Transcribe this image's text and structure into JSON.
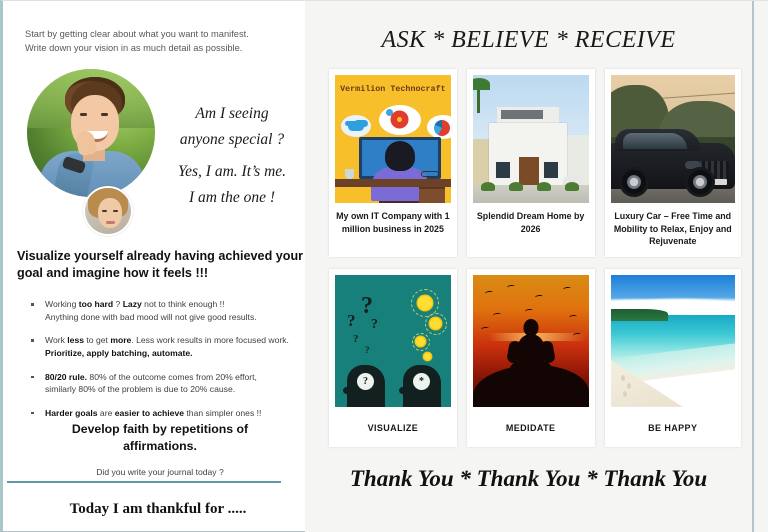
{
  "left": {
    "intro_line1": "Start by getting clear about what you want to manifest.",
    "intro_line2": "Write down your vision in as much detail as possible.",
    "quote_line1": "Am I seeing",
    "quote_line2": "anyone special ?",
    "quote_line3": "Yes, I am. It’s me.",
    "quote_line4": "I am the one !",
    "headline": "Visualize yourself already having achieved your goal and imagine how it feels !!!",
    "tips": [
      {
        "p1": "Working ",
        "b1": "too hard",
        "p2": " ? ",
        "b2": "Lazy",
        "p3": " not to think enough !!",
        "p4": "Anything done with bad mood will not give good results.",
        "b3": "",
        "p5": ""
      },
      {
        "p1": "Work ",
        "b1": "less",
        "p2": " to get ",
        "b2": "more",
        "p3": ". Less work results in more focused work. ",
        "p4": "",
        "b3": "Prioritize, apply batching, automate.",
        "p5": ""
      },
      {
        "p1": "",
        "b1": "80/20 rule.",
        "p2": " 80% of the outcome comes from 20% effort,",
        "b2": "",
        "p3": "",
        "p4": "similarly 80% of the problem is due to 20% cause.",
        "b3": "",
        "p5": ""
      },
      {
        "p1": "",
        "b1": "Harder goals",
        "p2": " are ",
        "b2": "easier to achieve",
        "p3": " than simpler ones !!",
        "p4": "",
        "b3": "",
        "p5": ""
      }
    ],
    "develop_line1": "Develop faith by repetitions of",
    "develop_line2": "affirmations.",
    "journal": "Did you write your journal today ?",
    "thankful": "Today I am thankful for ....."
  },
  "right": {
    "banner_top": "ASK * BELIEVE * RECEIVE",
    "banner_bottom": "Thank You * Thank You * Thank You",
    "cards": [
      {
        "image": "it-company-illustration",
        "image_title": "Vermilion Technocraft",
        "caption": "My own IT Company with 1 million business in 2025"
      },
      {
        "image": "dream-home-photo",
        "caption": "Splendid Dream Home by 2026"
      },
      {
        "image": "luxury-car-photo",
        "caption": "Luxury Car – Free Time and Mobility to Relax, Enjoy and Rejuvenate"
      },
      {
        "image": "visualize-heads-illustration",
        "caption": "VISUALIZE"
      },
      {
        "image": "meditation-sunset-photo",
        "caption": "MEDIDATE"
      },
      {
        "image": "tropical-beach-photo",
        "caption": "BE HAPPY"
      }
    ]
  },
  "colors": {
    "left_border": "#a9c7c9",
    "divider_rule": "#5e9aa5",
    "right_panel_bg": "#f5f5f4",
    "right_edge_line": "#b4c4cf",
    "it_yellow": "#f7c02a",
    "visualize_teal": "#17807b"
  }
}
